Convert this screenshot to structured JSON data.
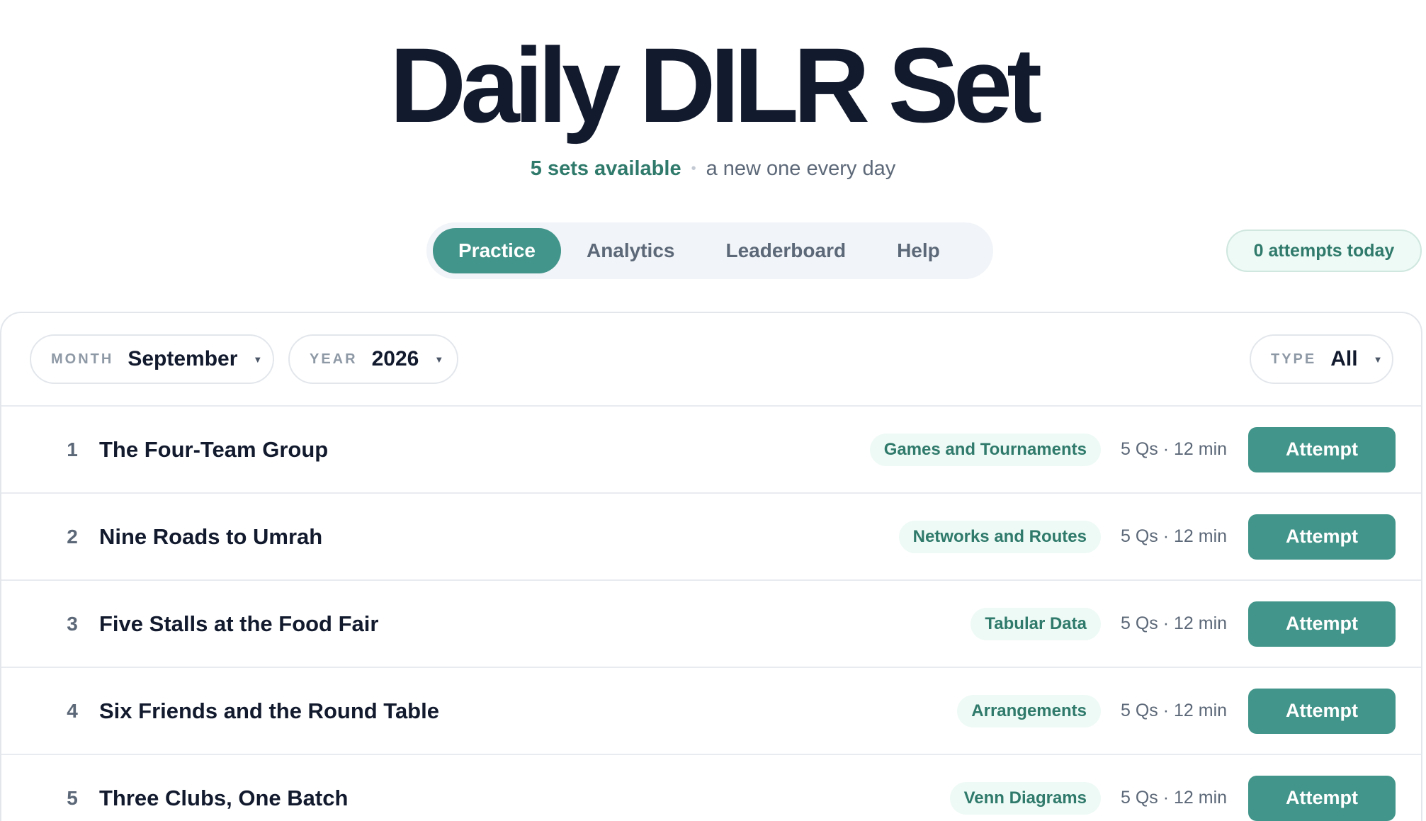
{
  "header": {
    "title": "Daily DILR Set",
    "available": "5 sets available",
    "separator": "•",
    "note": "a new one every day"
  },
  "tabs": [
    {
      "label": "Practice",
      "active": true
    },
    {
      "label": "Analytics",
      "active": false
    },
    {
      "label": "Leaderboard",
      "active": false
    },
    {
      "label": "Help",
      "active": false
    }
  ],
  "attempts_badge": "0 attempts today",
  "filters": {
    "month": {
      "label": "MONTH",
      "value": "September"
    },
    "year": {
      "label": "YEAR",
      "value": "2026"
    },
    "type": {
      "label": "TYPE",
      "value": "All"
    }
  },
  "sets": [
    {
      "num": "1",
      "title": "The Four-Team Group",
      "tag": "Games and Tournaments",
      "meta": "5 Qs · 12 min",
      "action": "Attempt"
    },
    {
      "num": "2",
      "title": "Nine Roads to Umrah",
      "tag": "Networks and Routes",
      "meta": "5 Qs · 12 min",
      "action": "Attempt"
    },
    {
      "num": "3",
      "title": "Five Stalls at the Food Fair",
      "tag": "Tabular Data",
      "meta": "5 Qs · 12 min",
      "action": "Attempt"
    },
    {
      "num": "4",
      "title": "Six Friends and the Round Table",
      "tag": "Arrangements",
      "meta": "5 Qs · 12 min",
      "action": "Attempt"
    },
    {
      "num": "5",
      "title": "Three Clubs, One Batch",
      "tag": "Venn Diagrams",
      "meta": "5 Qs · 12 min",
      "action": "Attempt"
    }
  ],
  "colors": {
    "accent": "#42958a",
    "accent_text": "#2f7a6b",
    "tag_bg": "#eefaf6",
    "title": "#121a2e",
    "muted": "#5c6878"
  }
}
